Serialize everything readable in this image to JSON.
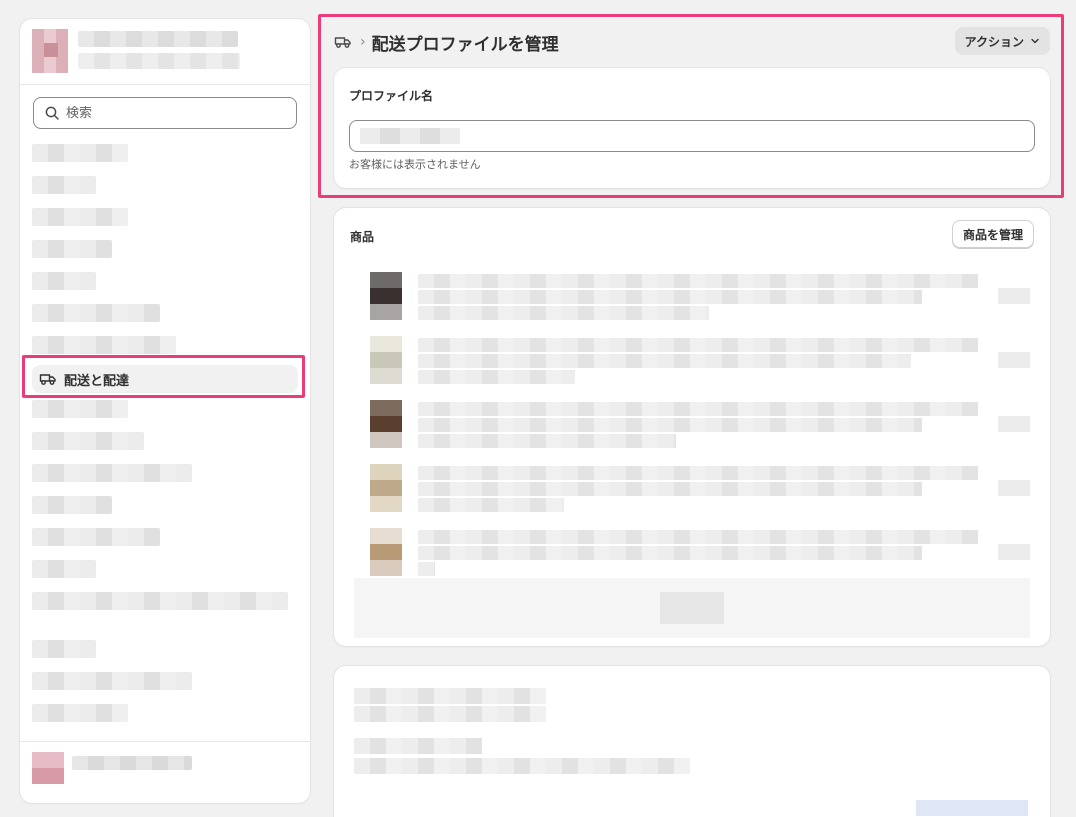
{
  "sidebar": {
    "search_placeholder": "検索",
    "active_item_label": "配送と配達"
  },
  "header": {
    "title": "配送プロファイルを管理",
    "action_label": "アクション"
  },
  "profile_card": {
    "title": "プロファイル名",
    "help_text": "お客様には表示されません"
  },
  "products_card": {
    "title": "商品",
    "manage_label": "商品を管理"
  },
  "colors": {
    "highlight": "#ec3b7a",
    "background": "#f1f1f1",
    "card": "#ffffff"
  }
}
